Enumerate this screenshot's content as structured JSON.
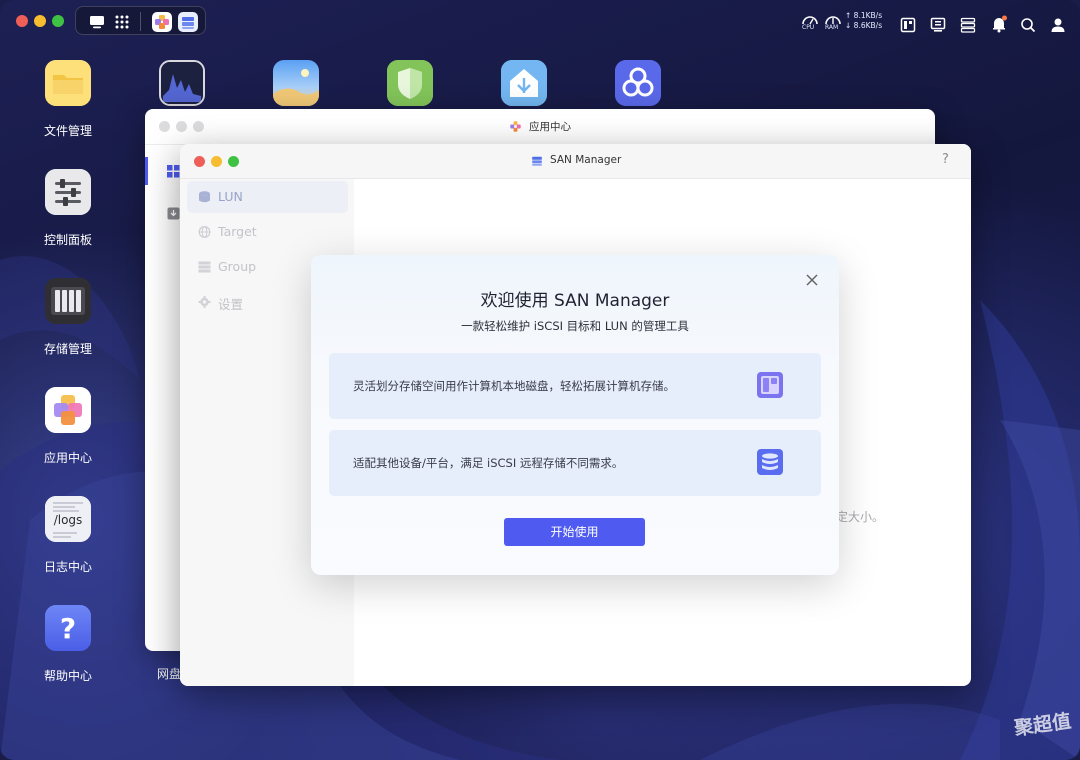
{
  "desktop": {
    "icons": [
      {
        "label": "文件管理"
      },
      {
        "label": "控制面板"
      },
      {
        "label": "存储管理"
      },
      {
        "label": "应用中心"
      },
      {
        "label": "日志中心",
        "image_text": "/logs"
      },
      {
        "label": "帮助中心"
      },
      {
        "label": "网盘"
      }
    ]
  },
  "tray": {
    "cpu_label": "CPU",
    "ram_label": "RAM",
    "upload_speed": "8.1KB/s",
    "download_speed": "8.6KB/s"
  },
  "back_window": {
    "title": "应用中心"
  },
  "front_window": {
    "title": "SAN Manager",
    "help_label": "?",
    "sidebar": [
      {
        "label": "LUN",
        "icon": "database-icon"
      },
      {
        "label": "Target",
        "icon": "globe-icon"
      },
      {
        "label": "Group",
        "icon": "layers-icon"
      },
      {
        "label": "设置",
        "icon": "gear-icon"
      }
    ],
    "partial_text": "定大小。"
  },
  "modal": {
    "title": "欢迎使用 SAN Manager",
    "subtitle": "一款轻松维护 iSCSI 目标和 LUN 的管理工具",
    "features": [
      {
        "text": "灵活划分存储空间用作计算机本地磁盘，轻松拓展计算机存储。",
        "icon": "partition-icon"
      },
      {
        "text": "适配其他设备/平台，满足 iSCSI 远程存储不同需求。",
        "icon": "server-stack-icon"
      }
    ],
    "start_button": "开始使用",
    "close_icon": "close-icon"
  },
  "watermark": "聚超值",
  "colors": {
    "accent": "#4f5bf0",
    "feature_bg": "#e6edfb",
    "light_red": "#ee5f57",
    "light_yellow": "#f5bd2f",
    "light_green": "#3fc244"
  }
}
